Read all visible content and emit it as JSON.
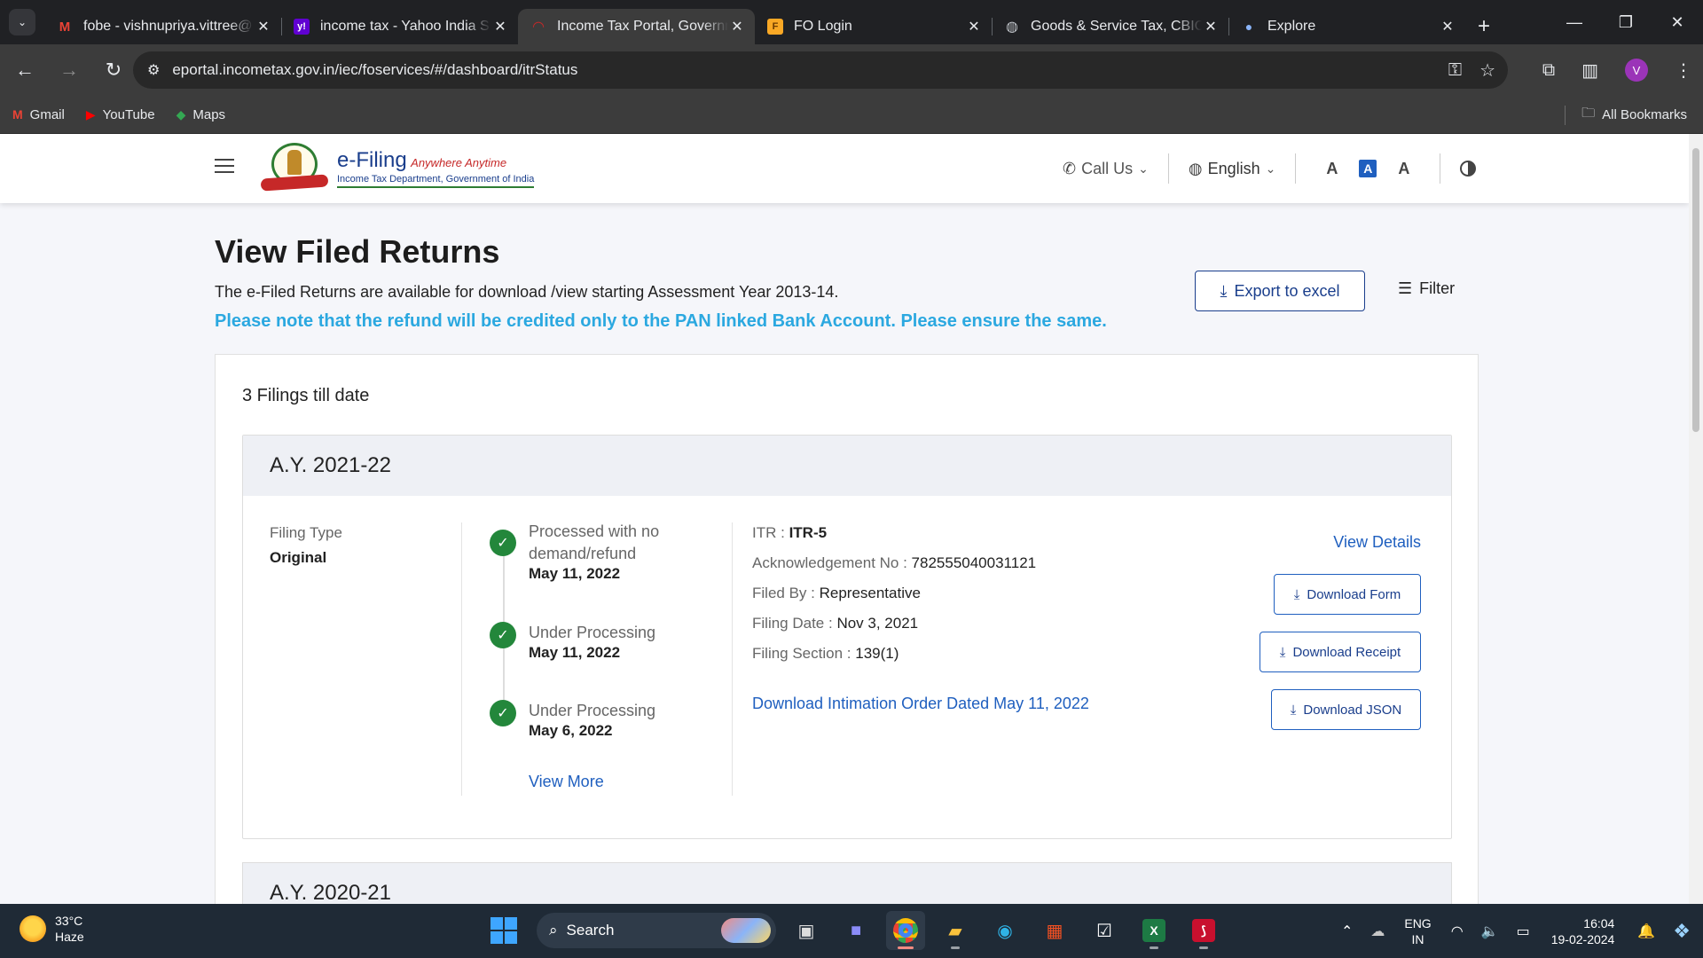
{
  "browser": {
    "tabs": [
      {
        "title": "fobe - vishnupriya.vittree@",
        "favicon": "gmail-icon",
        "color": "#ea4335",
        "glyph": "M"
      },
      {
        "title": "income tax - Yahoo India S",
        "favicon": "yahoo-icon",
        "color": "#6001d2",
        "glyph": "y!"
      },
      {
        "title": "Income Tax Portal, Governm",
        "favicon": "efiling-icon",
        "color": "#c62828",
        "glyph": "◠",
        "active": true
      },
      {
        "title": "FO Login",
        "favicon": "fo-icon",
        "color": "#f9a825",
        "glyph": "F"
      },
      {
        "title": "Goods & Service Tax, CBIC",
        "favicon": "globe-icon",
        "color": "#5f6368",
        "glyph": "◍"
      },
      {
        "title": "Explore",
        "favicon": "explore-icon",
        "color": "#4a5bd4",
        "glyph": "●"
      }
    ],
    "url": "eportal.incometax.gov.in/iec/foservices/#/dashboard/itrStatus",
    "profile_initial": "V",
    "bookmarks": [
      {
        "label": "Gmail",
        "icon": "gmail-icon",
        "glyph": "M",
        "color": "#ea4335"
      },
      {
        "label": "YouTube",
        "icon": "youtube-icon",
        "glyph": "▶",
        "color": "#ff0000"
      },
      {
        "label": "Maps",
        "icon": "maps-icon",
        "glyph": "◆",
        "color": "#34a853"
      }
    ],
    "all_bookmarks": "All Bookmarks"
  },
  "header": {
    "logo_title": "e-Filing",
    "logo_tagline": "Anywhere Anytime",
    "logo_dept": "Income Tax Department, Government of India",
    "call_us": "Call Us",
    "language": "English",
    "font_dec": "A",
    "font_normal": "A",
    "font_inc": "A"
  },
  "main": {
    "title": "View Filed Returns",
    "subtitle": "The e-Filed Returns are available for download /view starting Assessment Year 2013-14.",
    "note": "Please note that the refund will be credited only to the PAN linked Bank Account. Please ensure the same.",
    "export_label": "Export to excel",
    "filter_label": "Filter",
    "filings_count": "3 Filings till date"
  },
  "filing": {
    "ay": "A.Y. 2021-22",
    "filing_type_label": "Filing Type",
    "filing_type": "Original",
    "timeline": [
      {
        "status": "Processed with no demand/refund",
        "date": "May 11, 2022"
      },
      {
        "status": "Under Processing",
        "date": "May 11, 2022"
      },
      {
        "status": "Under Processing",
        "date": "May 6, 2022"
      }
    ],
    "view_more": "View More",
    "itr_label": "ITR : ",
    "itr": "ITR-5",
    "ack_label": "Acknowledgement No : ",
    "ack": "782555040031121",
    "filed_by_label": "Filed By : ",
    "filed_by": "Representative",
    "filing_date_label": "Filing Date : ",
    "filing_date": "Nov 3, 2021",
    "section_label": "Filing Section : ",
    "section": "139(1)",
    "intimation": "Download Intimation Order Dated May 11, 2022",
    "view_details": "View Details",
    "download_form": "Download Form",
    "download_receipt": "Download Receipt",
    "download_json": "Download JSON"
  },
  "filing2": {
    "ay": "A.Y. 2020-21"
  },
  "taskbar": {
    "temp": "33°C",
    "weather": "Haze",
    "search": "Search",
    "lang_top": "ENG",
    "lang_bottom": "IN",
    "time": "16:04",
    "date": "19-02-2024"
  }
}
